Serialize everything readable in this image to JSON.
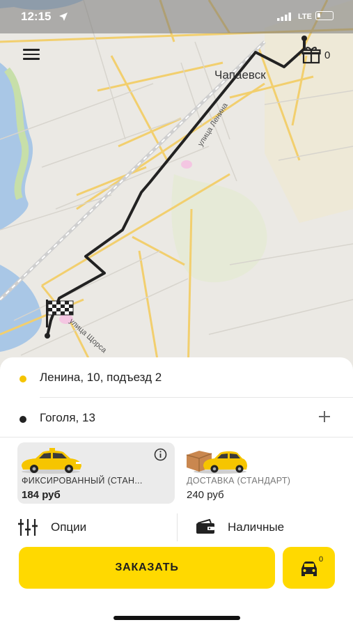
{
  "status_bar": {
    "time": "12:15",
    "network": "LTE"
  },
  "map": {
    "city": "Чапаевск",
    "street_lenina": "улица Ленина",
    "street_shorsa": "улица Щорса"
  },
  "header": {
    "gift_count": "0"
  },
  "route": {
    "from": "Ленина, 10, подъезд 2",
    "to": "Гоголя, 13"
  },
  "tariffs": [
    {
      "name": "ФИКСИРОВАННЫЙ (СТАН...",
      "price": "184 руб"
    },
    {
      "name": "ДОСТАВКА (СТАНДАРТ)",
      "price": "240 руб"
    }
  ],
  "options": {
    "options_label": "Опции",
    "payment_label": "Наличные"
  },
  "order": {
    "label": "ЗАКАЗАТЬ",
    "car_count": "0"
  },
  "colors": {
    "accent": "#ffd900",
    "from_dot": "#f5c400",
    "to_dot": "#222222"
  }
}
